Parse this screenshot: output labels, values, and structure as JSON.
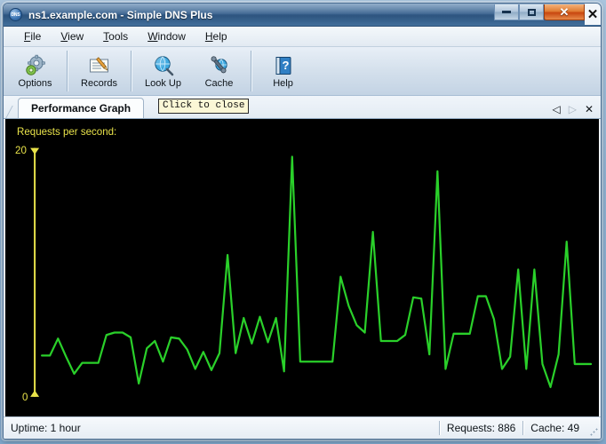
{
  "window": {
    "title": "ns1.example.com - Simple DNS Plus",
    "app_icon": "dns-circle-icon",
    "controls": {
      "minimize": "minimize-icon",
      "maximize": "maximize-icon",
      "close": "close-icon",
      "outer_close_label": "✕"
    }
  },
  "menubar": {
    "items": [
      {
        "label": "File",
        "accel": "F"
      },
      {
        "label": "View",
        "accel": "V"
      },
      {
        "label": "Tools",
        "accel": "T"
      },
      {
        "label": "Window",
        "accel": "W"
      },
      {
        "label": "Help",
        "accel": "H"
      }
    ]
  },
  "toolbar": {
    "buttons": [
      {
        "label": "Options",
        "icon": "gears-icon"
      },
      {
        "label": "Records",
        "icon": "note-pencil-icon"
      },
      {
        "label": "Look Up",
        "icon": "globe-magnifier-icon"
      },
      {
        "label": "Cache",
        "icon": "wrench-globe-icon"
      },
      {
        "label": "Help",
        "icon": "question-book-icon"
      }
    ]
  },
  "tabs": {
    "active": "Performance Graph",
    "items": [
      "Performance Graph"
    ],
    "tooltip": "Click to close",
    "nav": {
      "prev": "◁",
      "next": "▷",
      "close": "✕"
    }
  },
  "statusbar": {
    "uptime": "Uptime: 1 hour",
    "requests": "Requests: 886",
    "cache": "Cache: 49",
    "grip": "resize-grip-icon"
  },
  "colors": {
    "graph_background": "#000000",
    "graph_line": "#2ad02a",
    "axis": "#e8e24a",
    "titlebar": "#39628f",
    "close_button": "#c8470f"
  },
  "chart_data": {
    "type": "line",
    "title": "Requests per second:",
    "xlabel": "",
    "ylabel": "Requests per second",
    "ylim": [
      0,
      20
    ],
    "ytick_labels": [
      "20",
      "0"
    ],
    "ytick_values": [
      20,
      0
    ],
    "grid": false,
    "legend": null,
    "line_color": "#2ad02a",
    "background": "#000000",
    "axis_color": "#e8e24a",
    "x": [
      0,
      1,
      2,
      3,
      4,
      5,
      6,
      7,
      8,
      9,
      10,
      11,
      12,
      13,
      14,
      15,
      16,
      17,
      18,
      19,
      20,
      21,
      22,
      23,
      24,
      25,
      26,
      27,
      28,
      29,
      30,
      31,
      32,
      33,
      34,
      35,
      36,
      37,
      38,
      39,
      40,
      41,
      42,
      43,
      44,
      45,
      46,
      47,
      48,
      49,
      50,
      51,
      52,
      53,
      54,
      55,
      56,
      57,
      58,
      59,
      60,
      61,
      62,
      63,
      64,
      65,
      66,
      67,
      68,
      69,
      70,
      71,
      72,
      73,
      74,
      75
    ],
    "values": [
      3.1,
      3.1,
      4.5,
      3.0,
      1.6,
      2.5,
      2.5,
      2.5,
      4.8,
      5.0,
      5.0,
      4.6,
      0.8,
      3.7,
      4.3,
      2.6,
      4.6,
      4.5,
      3.6,
      2.0,
      3.4,
      1.9,
      3.3,
      11.4,
      3.3,
      6.2,
      4.1,
      6.3,
      4.2,
      6.2,
      1.8,
      19.5,
      2.6,
      2.6,
      2.6,
      2.6,
      2.6,
      9.6,
      7.2,
      5.6,
      5.0,
      13.3,
      4.3,
      4.3,
      4.3,
      4.8,
      7.9,
      7.8,
      3.2,
      18.3,
      2.0,
      4.9,
      4.9,
      4.9,
      8.0,
      8.0,
      6.1,
      2.0,
      3.0,
      10.2,
      2.0,
      10.2,
      2.4,
      0.5,
      3.2,
      12.5,
      2.4,
      2.4,
      2.4
    ]
  }
}
